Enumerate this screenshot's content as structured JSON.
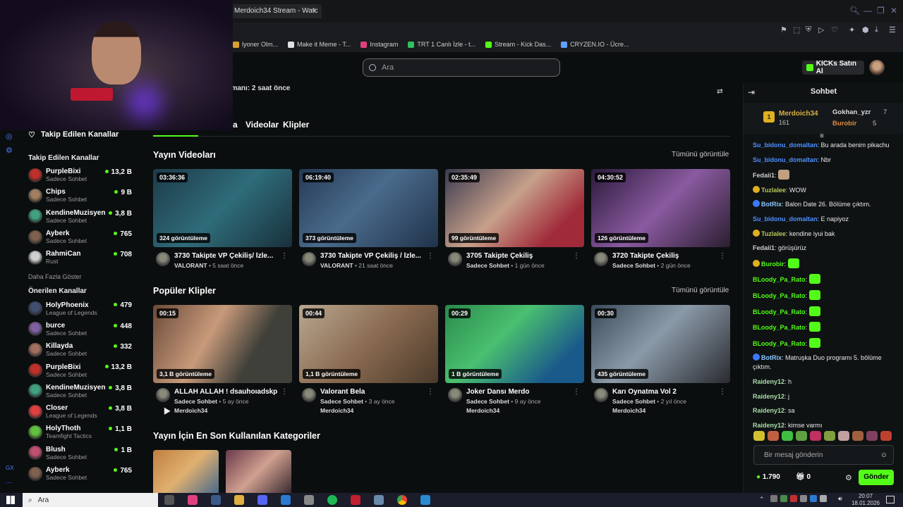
{
  "browser": {
    "tab_title": "Merdoich34 Stream - Watc",
    "new_tab": "+",
    "bookmarks": [
      {
        "label": "lyoner Olm...",
        "color": "#d8a030"
      },
      {
        "label": "Make it Meme - T...",
        "color": "#e0e0e0"
      },
      {
        "label": "Instagram",
        "color": "#e04080"
      },
      {
        "label": "TRT 1 Canlı İzle - t...",
        "color": "#30c060"
      },
      {
        "label": "Stream - Kick Das...",
        "color": "#53fc18"
      },
      {
        "label": "CRYZEN.IO - Ücre...",
        "color": "#60a0ff"
      }
    ]
  },
  "header": {
    "search_placeholder": "Ara",
    "buy_kicks": "KICKs Satın Al"
  },
  "channel": {
    "last_live": "n zamanı: 2 saat önce",
    "tabs": [
      "a",
      "Videolar",
      "Klipler"
    ]
  },
  "sidebar": {
    "following_header": "Takip Edilen Kanallar",
    "following_title": "Takip Edilen Kanallar",
    "following": [
      {
        "name": "PurpleBixi",
        "sub": "Sadece Sohbet",
        "count": "13,2 B",
        "color": "#c0302a"
      },
      {
        "name": "Chips",
        "sub": "Sadece Sohbet",
        "count": "9 B",
        "color": "#a08060"
      },
      {
        "name": "KendineMuzisyen",
        "sub": "Sadece Sohbet",
        "count": "3,8 B",
        "color": "#40a080"
      },
      {
        "name": "Ayberk",
        "sub": "Sadece Sohbet",
        "count": "765",
        "color": "#806050"
      },
      {
        "name": "RahmiCan",
        "sub": "Rust",
        "count": "708",
        "color": "#d0d0d0"
      }
    ],
    "show_more": "Daha Fazla Göster",
    "recommended_title": "Önerilen Kanallar",
    "recommended": [
      {
        "name": "HolyPhoenix",
        "sub": "League of Legends",
        "count": "479",
        "color": "#405070"
      },
      {
        "name": "burce",
        "sub": "Sadece Sohbet",
        "count": "448",
        "color": "#8060a0"
      },
      {
        "name": "Killayda",
        "sub": "Sadece Sohbet",
        "count": "332",
        "color": "#a07060"
      },
      {
        "name": "PurpleBixi",
        "sub": "Sadece Sohbet",
        "count": "13,2 B",
        "color": "#c0302a"
      },
      {
        "name": "KendineMuzisyen",
        "sub": "Sadece Sohbet",
        "count": "3,8 B",
        "color": "#40a080"
      },
      {
        "name": "Closer",
        "sub": "League of Legends",
        "count": "3,8 B",
        "color": "#e04040"
      },
      {
        "name": "HolyThoth",
        "sub": "Teamfight Tactics",
        "count": "1,1 B",
        "color": "#60c040"
      },
      {
        "name": "Blush",
        "sub": "Sadece Sohbet",
        "count": "1 B",
        "color": "#c05070"
      },
      {
        "name": "Ayberk",
        "sub": "Sadece Sohbet",
        "count": "765",
        "color": "#806050"
      }
    ]
  },
  "videos": {
    "title": "Yayın Videoları",
    "see_all": "Tümünü görüntüle",
    "items": [
      {
        "duration": "03:36:36",
        "views": "324 görüntüleme",
        "title": "3730 Takipte VP Çekiliş/ İzle...",
        "category": "VALORANT",
        "age": "5 saat önce",
        "bg": "linear-gradient(135deg,#1d3a48,#2f6c7a 50%,#18303a)"
      },
      {
        "duration": "06:19:40",
        "views": "373 görüntüleme",
        "title": "3730 Takipte VP Çekiliş / İzle...",
        "category": "VALORANT",
        "age": "21 saat önce",
        "bg": "linear-gradient(135deg,#243a55,#4a6b8c 45%,#20324a)"
      },
      {
        "duration": "02:35:49",
        "views": "99 görüntüleme",
        "title": "3705 Takipte Çekiliş",
        "category": "Sadece Sohbet",
        "age": "1 gün önce",
        "bg": "linear-gradient(135deg,#3a3a50,#c7a08a 45%,#a02a3a 80%)"
      },
      {
        "duration": "04:30:52",
        "views": "126 görüntüleme",
        "title": "3720 Takipte Çekiliş",
        "category": "Sadece Sohbet",
        "age": "2 gün önce",
        "bg": "linear-gradient(135deg,#2a1a3a,#8a5aa0 50%,#2a1e30)"
      }
    ]
  },
  "clips": {
    "title": "Popüler Klipler",
    "see_all": "Tümünü görüntüle",
    "items": [
      {
        "duration": "00:15",
        "views": "3,1 B görüntüleme",
        "title": "ALLAH ALLAH ! dsauhoıadskp",
        "category": "Sadece Sohbet",
        "age": "5 ay önce",
        "author": "Merdoich34",
        "bg": "linear-gradient(120deg,#6a4a3a,#c89a7a 40%,#40403a 70%)"
      },
      {
        "duration": "00:44",
        "views": "1,1 B görüntüleme",
        "title": "Valorant Bela",
        "category": "Sadece Sohbet",
        "age": "3 ay önce",
        "author": "Merdoich34",
        "bg": "linear-gradient(135deg,#b8a890,#8a6a50 50%,#4a3a2a)"
      },
      {
        "duration": "00:29",
        "views": "1 B görüntüleme",
        "title": "Joker Dansı Merdo",
        "category": "Sadece Sohbet",
        "age": "9 ay önce",
        "author": "Merdoich34",
        "bg": "linear-gradient(135deg,#2a8a4a,#4ac070 40%,#1a5a8a 80%)"
      },
      {
        "duration": "00:30",
        "views": "435 görüntüleme",
        "title": "Karı Oynatma Vol 2",
        "category": "Sadece Sohbet",
        "age": "2 yıl önce",
        "author": "Merdoich34",
        "bg": "linear-gradient(135deg,#3a4a5a,#8a9aa8 45%,#2a2a30)"
      }
    ]
  },
  "categories": {
    "title": "Yayın İçin En Son Kullanılan Kategoriler",
    "items": [
      {
        "bg": "linear-gradient(135deg,#c08040,#e0b070 50%,#4a6a8a)"
      },
      {
        "bg": "linear-gradient(135deg,#6a3a4a,#d0a090 50%,#3a2a30)"
      }
    ]
  },
  "chat": {
    "title": "Sohbet",
    "pinned": {
      "user": "Merdoich34",
      "count": "161",
      "u2": "Gokhan_yzr",
      "u2count": "7",
      "u3": "Burobir",
      "u3count": "5"
    },
    "messages": [
      {
        "user": "Su_bidonu_domaltan",
        "cls": "u1",
        "text": "Bu arada benim pikachu"
      },
      {
        "user": "Su_bidonu_domaltan",
        "cls": "u1",
        "text": "Nbr"
      },
      {
        "user": "Fedaii1",
        "cls": "u2",
        "text": "",
        "emote": "#c0a080"
      },
      {
        "user": "Tuzlalee",
        "cls": "u3",
        "text": "WOW",
        "badge": "#e0b020"
      },
      {
        "user": "BotRix",
        "cls": "u4",
        "text": "Balon Date 26. Bölüme çıktım.",
        "badge": "#3a7aff"
      },
      {
        "user": "Su_bidonu_domaltan",
        "cls": "u1",
        "text": "E napiyoz"
      },
      {
        "user": "Tuzlalee",
        "cls": "u3",
        "text": "kendine iyui bak",
        "badge": "#e0b020"
      },
      {
        "user": "Fedaii1",
        "cls": "u2",
        "text": "görüşürüz"
      },
      {
        "user": "Burobir",
        "cls": "u5",
        "text": "",
        "badge": "#e0b020",
        "emote": "#53fc18"
      },
      {
        "user": "BLoody_Pa_Rato",
        "cls": "u5",
        "text": "",
        "emote": "#53fc18"
      },
      {
        "user": "BLoody_Pa_Rato",
        "cls": "u5",
        "text": "",
        "emote": "#53fc18"
      },
      {
        "user": "BLoody_Pa_Rato",
        "cls": "u5",
        "text": "",
        "emote": "#53fc18"
      },
      {
        "user": "BLoody_Pa_Rato",
        "cls": "u5",
        "text": "",
        "emote": "#53fc18"
      },
      {
        "user": "BLoody_Pa_Rato",
        "cls": "u5",
        "text": "",
        "emote": "#53fc18"
      },
      {
        "user": "BotRix",
        "cls": "u4",
        "text": "Matruşka Duo programı 5. bölüme çıktım.",
        "badge": "#3a7aff"
      },
      {
        "user": "Raideny12",
        "cls": "u6",
        "text": "h"
      },
      {
        "user": "Raideny12",
        "cls": "u6",
        "text": "j"
      },
      {
        "user": "Raideny12",
        "cls": "u6",
        "text": "sa"
      },
      {
        "user": "Raideny12",
        "cls": "u6",
        "text": "kimse varmı"
      }
    ],
    "emote_bar": [
      "#d0c030",
      "#c06040",
      "#40c040",
      "#60a040",
      "#c03060",
      "#80a040",
      "#c0a0a0",
      "#a06040",
      "#804060",
      "#c04030"
    ],
    "input_placeholder": "Bir mesaj gönderin",
    "kicks_balance": "1.790",
    "gifts": "0",
    "send": "Gönder"
  },
  "taskbar": {
    "search_placeholder": "Ara",
    "time": "20:07",
    "date": "18.01.2026"
  }
}
